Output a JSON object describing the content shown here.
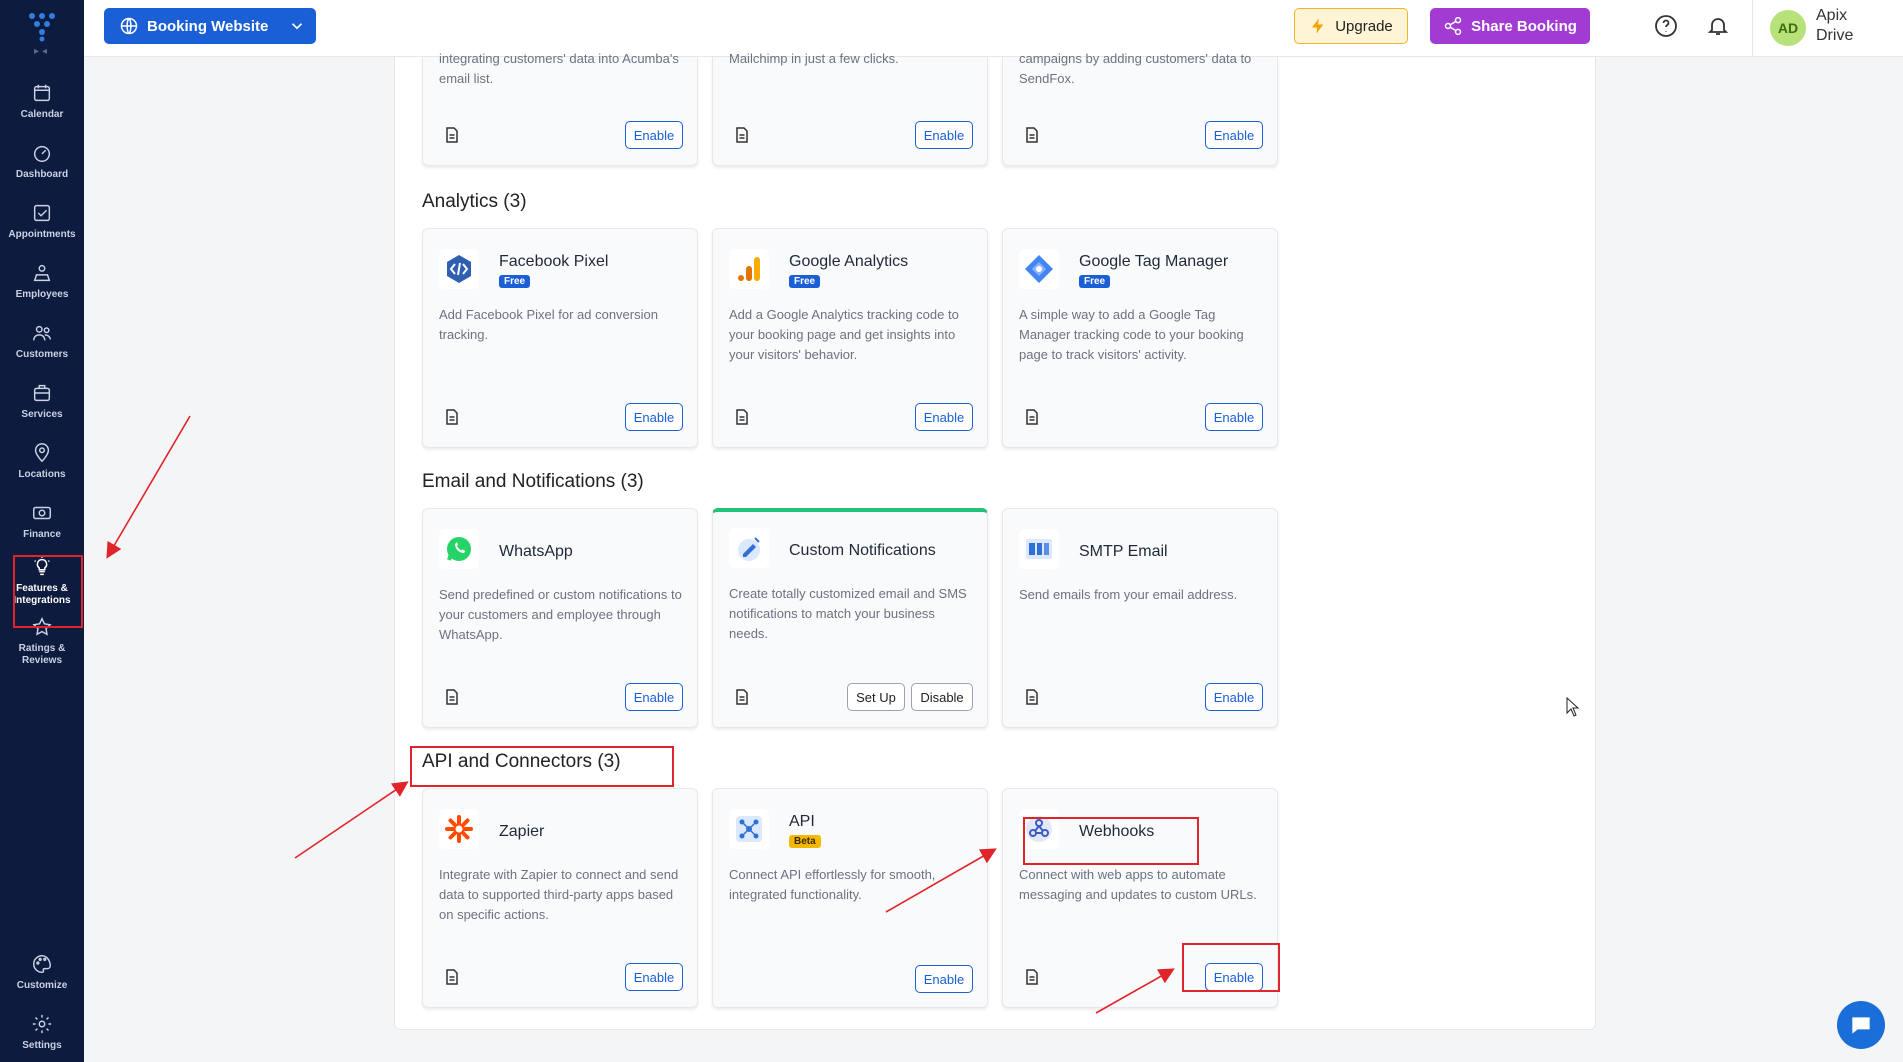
{
  "sidebar": {
    "items": [
      {
        "label": "Calendar",
        "icon": "calendar-icon"
      },
      {
        "label": "Dashboard",
        "icon": "dashboard-icon"
      },
      {
        "label": "Appointments",
        "icon": "appointments-icon"
      },
      {
        "label": "Employees",
        "icon": "employees-icon"
      },
      {
        "label": "Customers",
        "icon": "customers-icon"
      },
      {
        "label": "Services",
        "icon": "services-icon"
      },
      {
        "label": "Locations",
        "icon": "location-pin-icon"
      },
      {
        "label": "Finance",
        "icon": "finance-icon"
      },
      {
        "label": "Features & Integrations",
        "icon": "lightbulb-icon"
      },
      {
        "label": "Ratings & Reviews",
        "icon": "star-icon"
      }
    ],
    "bottom": [
      {
        "label": "Customize",
        "icon": "palette-icon"
      },
      {
        "label": "Settings",
        "icon": "gear-icon"
      }
    ]
  },
  "topbar": {
    "site_selector": "Booking Website",
    "upgrade": "Upgrade",
    "share": "Share Booking",
    "avatar_initials": "AD",
    "user_name": "Apix Drive"
  },
  "partial_cards": [
    {
      "desc": "integrating customers' data into Acumba's email list.",
      "button": "Enable"
    },
    {
      "desc": "Mailchimp in just a few clicks.",
      "button": "Enable"
    },
    {
      "desc": "campaigns by adding customers' data to SendFox.",
      "button": "Enable"
    }
  ],
  "sections": [
    {
      "title": "Analytics (3)",
      "cards": [
        {
          "title": "Facebook Pixel",
          "badge": "Free",
          "desc": "Add Facebook Pixel for ad conversion tracking.",
          "button": "Enable"
        },
        {
          "title": "Google Analytics",
          "badge": "Free",
          "desc": "Add a Google Analytics tracking code to your booking page and get insights into your visitors' behavior.",
          "button": "Enable"
        },
        {
          "title": "Google Tag Manager",
          "badge": "Free",
          "desc": "A simple way to add a Google Tag Manager tracking code to your booking page to track visitors' activity.",
          "button": "Enable"
        }
      ]
    },
    {
      "title": "Email and Notifications (3)",
      "cards": [
        {
          "title": "WhatsApp",
          "desc": "Send predefined or custom notifications to your customers and employee through WhatsApp.",
          "button": "Enable"
        },
        {
          "title": "Custom Notifications",
          "desc": "Create totally customized email and SMS notifications to match your business needs.",
          "button_setup": "Set Up",
          "button_disable": "Disable"
        },
        {
          "title": "SMTP Email",
          "desc": "Send emails from your email address.",
          "button": "Enable"
        }
      ]
    },
    {
      "title": "API and Connectors (3)",
      "cards": [
        {
          "title": "Zapier",
          "desc": "Integrate with Zapier to connect and send data to supported third-party apps based on specific actions.",
          "button": "Enable"
        },
        {
          "title": "API",
          "badge": "Beta",
          "desc": "Connect API effortlessly for smooth, integrated functionality.",
          "button": "Enable"
        },
        {
          "title": "Webhooks",
          "desc": "Connect with web apps to automate messaging and updates to custom URLs.",
          "button": "Enable"
        }
      ]
    }
  ],
  "colors": {
    "sidebar_bg": "#0d1b3e",
    "primary": "#1a5fd6",
    "share": "#a23bd1",
    "annotation": "#e0242a",
    "accent_green": "#22c27a"
  }
}
